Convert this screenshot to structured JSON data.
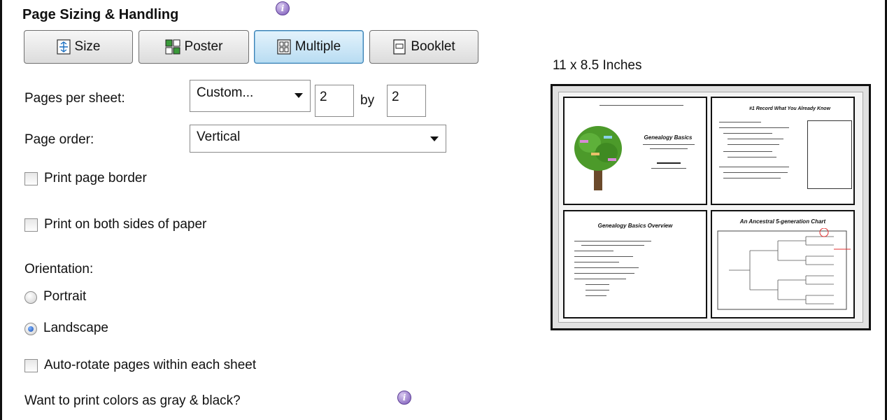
{
  "section": {
    "title": "Page Sizing & Handling"
  },
  "mode_buttons": {
    "size": "Size",
    "poster": "Poster",
    "multiple": "Multiple",
    "booklet": "Booklet",
    "selected": "Multiple"
  },
  "pages_per_sheet": {
    "label": "Pages per sheet:",
    "value": "Custom...",
    "columns": "2",
    "by_label": "by",
    "rows": "2"
  },
  "page_order": {
    "label": "Page order:",
    "value": "Vertical"
  },
  "options": {
    "print_page_border": {
      "label": "Print page border",
      "checked": false
    },
    "print_both_sides": {
      "label": "Print on both sides of paper",
      "checked": false
    },
    "auto_rotate": {
      "label": "Auto-rotate pages within each sheet",
      "checked": false
    }
  },
  "orientation": {
    "label": "Orientation:",
    "portrait": "Portrait",
    "landscape": "Landscape",
    "selected": "Landscape"
  },
  "gray_print": {
    "label": "Want to print colors as gray & black?"
  },
  "preview": {
    "paper_size": "11 x 8.5 Inches",
    "slides": [
      {
        "title": "Genealogy Basics"
      },
      {
        "title": "#1 Record What You Already Know"
      },
      {
        "title": "Genealogy Basics Overview"
      },
      {
        "title": "An Ancestral 5-generation Chart"
      }
    ]
  },
  "icons": {
    "info": "info-icon",
    "size": "size-icon",
    "poster": "poster-icon",
    "multiple": "multiple-pages-icon",
    "booklet": "booklet-icon"
  },
  "colors": {
    "selected_button": "#b8dcf2",
    "info_icon": "#7a58b8",
    "radio_selected": "#1a4fb0",
    "tree_foliage": "#4c9a2a"
  }
}
